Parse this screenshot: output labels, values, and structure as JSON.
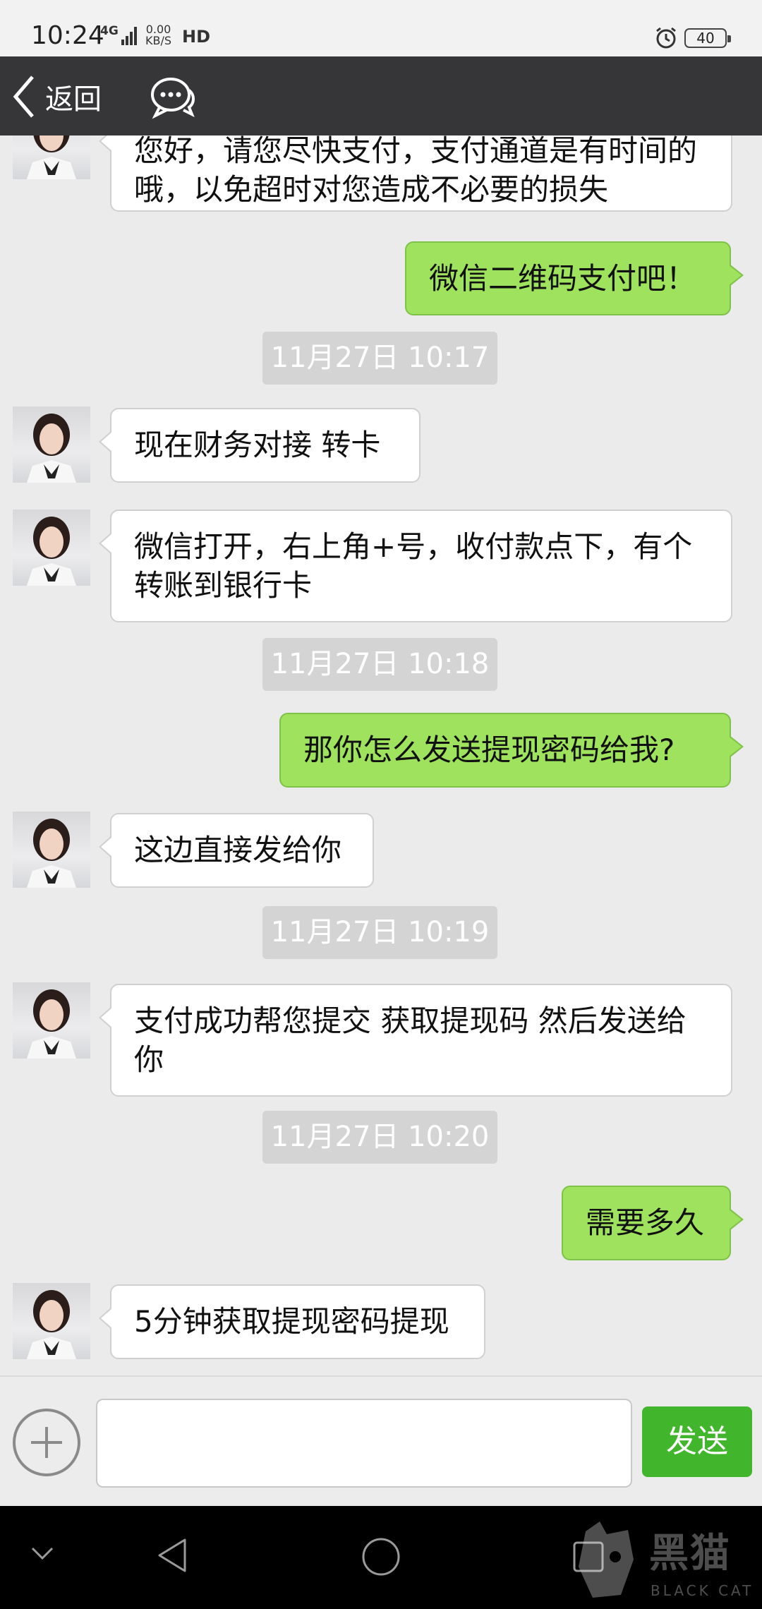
{
  "status_bar": {
    "time": "10:24",
    "network": "4G",
    "speed_value": "0.00",
    "speed_unit": "KB/S",
    "hd": "HD",
    "battery": "40"
  },
  "header": {
    "back_label": "返回",
    "back_icon": "chevron-left-icon",
    "chat_icon": "chat-bubbles-icon"
  },
  "messages": [
    {
      "type": "in",
      "text": "您好，请您尽快支付，支付通道是有时间的哦，以免超时对您造成不必要的损失"
    },
    {
      "type": "out",
      "text": "微信二维码支付吧！"
    },
    {
      "type": "time",
      "text": "11月27日 10:17"
    },
    {
      "type": "in",
      "text": "现在财务对接  转卡"
    },
    {
      "type": "in",
      "text": "微信打开，右上角+号，收付款点下，有个转账到银行卡"
    },
    {
      "type": "time",
      "text": "11月27日 10:18"
    },
    {
      "type": "out",
      "text": "那你怎么发送提现密码给我?"
    },
    {
      "type": "in",
      "text": "这边直接发给你"
    },
    {
      "type": "time",
      "text": "11月27日 10:19"
    },
    {
      "type": "in",
      "text": "支付成功帮您提交  获取提现码  然后发送给你"
    },
    {
      "type": "time",
      "text": "11月27日 10:20"
    },
    {
      "type": "out",
      "text": "需要多久"
    },
    {
      "type": "in",
      "text": "5分钟获取提现密码提现"
    }
  ],
  "input_bar": {
    "plus_icon": "plus-circle-icon",
    "input_value": "",
    "send_label": "发送"
  },
  "nav_bar": {
    "items": [
      "collapse-icon",
      "back-triangle-icon",
      "home-circle-icon",
      "recents-square-icon"
    ]
  },
  "watermark": {
    "text": "黑猫",
    "sub": "BLACK CAT"
  },
  "colors": {
    "header_bg": "#363639",
    "out_bubble": "#9ee25d",
    "send_button": "#41b52b",
    "chat_bg": "#ebebeb"
  }
}
